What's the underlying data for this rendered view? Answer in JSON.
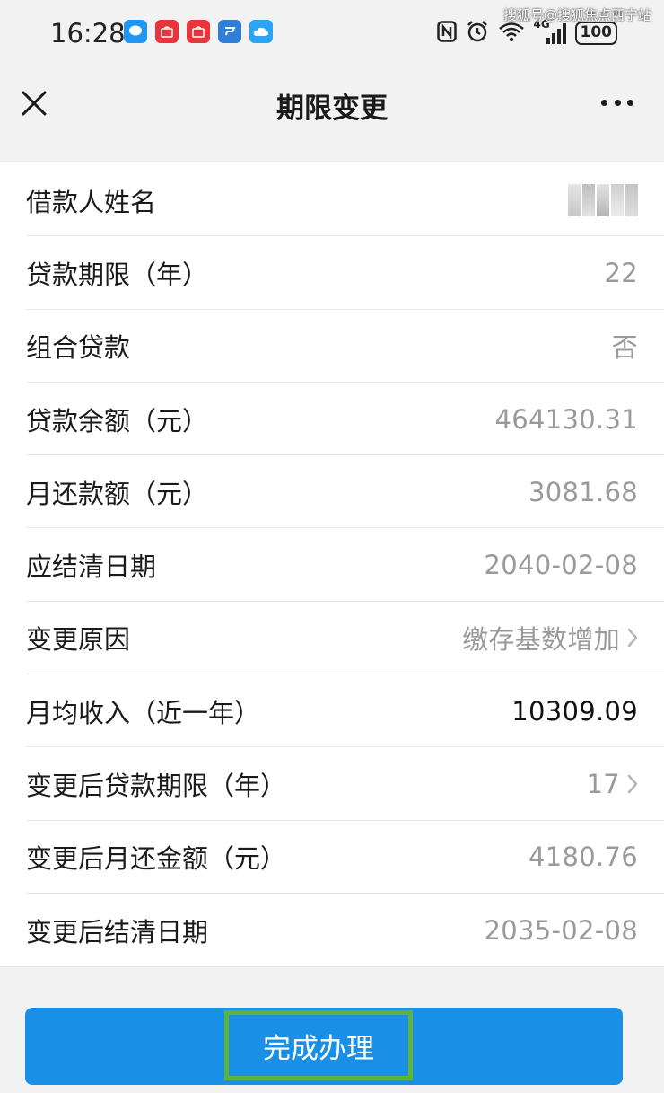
{
  "status_bar": {
    "time": "16:28",
    "battery": "100",
    "network": "4G",
    "watermark": "搜狐号@搜狐焦点西宁站",
    "app_icons": [
      "messages-icon",
      "huawei-mall-icon",
      "huawei-mall-icon",
      "browser-icon",
      "cloud-icon"
    ],
    "status_icons": [
      "nfc-icon",
      "alarm-icon",
      "wifi-icon",
      "signal-icon"
    ]
  },
  "nav": {
    "title": "期限变更",
    "close_icon": "close-icon",
    "more_icon": "more-icon"
  },
  "rows": [
    {
      "label": "借款人姓名",
      "value": "",
      "masked": true
    },
    {
      "label": "贷款期限（年）",
      "value": "22"
    },
    {
      "label": "组合贷款",
      "value": "否"
    },
    {
      "label": "贷款余额（元）",
      "value": "464130.31"
    },
    {
      "label": "月还款额（元）",
      "value": "3081.68"
    },
    {
      "label": "应结清日期",
      "value": "2040-02-08"
    },
    {
      "label": "变更原因",
      "value": "缴存基数增加",
      "chevron": true
    },
    {
      "label": "月均收入（近一年）",
      "value": "10309.09",
      "dark": true
    },
    {
      "label": "变更后贷款期限（年）",
      "value": "17",
      "chevron": true
    },
    {
      "label": "变更后月还金额（元）",
      "value": "4180.76"
    },
    {
      "label": "变更后结清日期",
      "value": "2035-02-08"
    }
  ],
  "action": {
    "label": "完成办理"
  },
  "colors": {
    "background": "#f2f2f2",
    "primary_button": "#1a8fe6",
    "highlight_border": "#5fb33c",
    "value_gray": "#9a9a9a"
  }
}
